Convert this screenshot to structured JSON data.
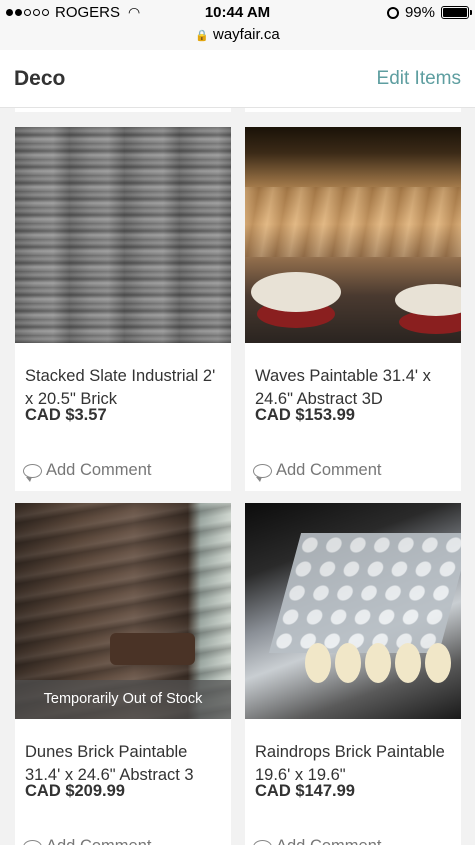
{
  "status_bar": {
    "carrier": "ROGERS",
    "time": "10:44 AM",
    "url": "wayfair.ca",
    "battery": "99%",
    "battery_level": 0.99
  },
  "header": {
    "title": "Deco",
    "edit_label": "Edit Items"
  },
  "products": [
    {
      "title": "Stacked Slate Industrial 2' x 20.5\" Brick",
      "price": "CAD $3.57",
      "comment_label": "Add Comment",
      "badge": "",
      "image_icon": "stacked-slate-image"
    },
    {
      "title": "Waves Paintable 31.4' x 24.6\" Abstract 3D",
      "price": "CAD $153.99",
      "comment_label": "Add Comment",
      "badge": "",
      "image_icon": "waves-panel-image"
    },
    {
      "title": "Dunes Brick Paintable 31.4' x 24.6\" Abstract 3",
      "price": "CAD $209.99",
      "comment_label": "Add Comment",
      "badge": "Temporarily Out of Stock",
      "image_icon": "dunes-panel-image"
    },
    {
      "title": "Raindrops Brick Paintable 19.6' x 19.6\"",
      "price": "CAD $147.99",
      "comment_label": "Add Comment",
      "badge": "",
      "image_icon": "raindrops-panel-image"
    }
  ],
  "colors": {
    "accent": "#5e9ea0",
    "page_background": "#f2f2f2",
    "badge_background": "#505050"
  }
}
